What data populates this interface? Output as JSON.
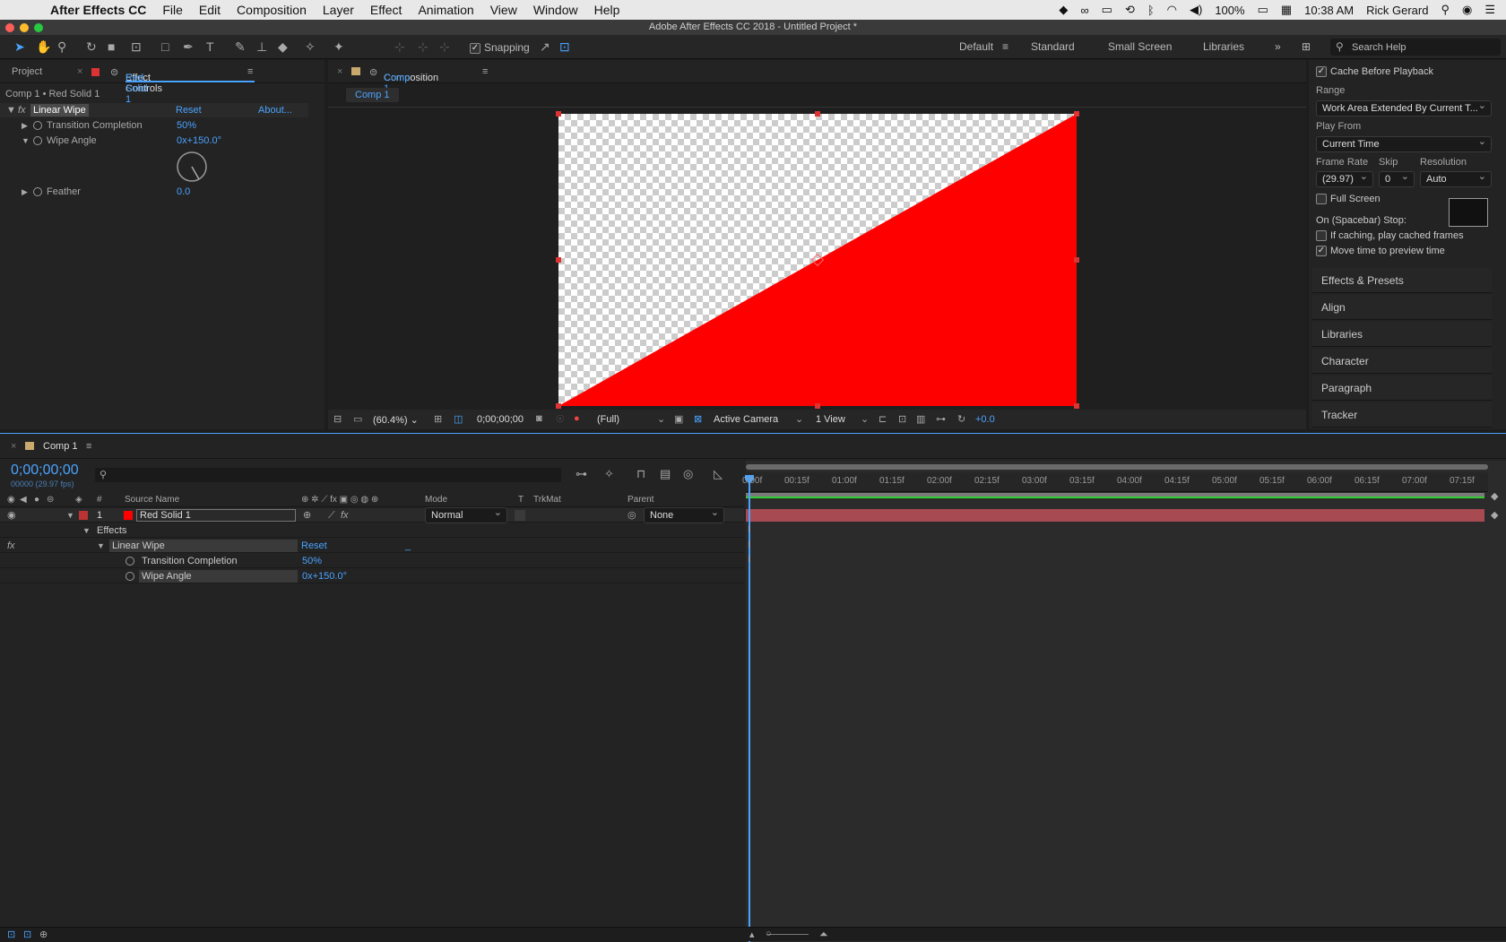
{
  "menubar": {
    "app": "After Effects CC",
    "items": [
      "File",
      "Edit",
      "Composition",
      "Layer",
      "Effect",
      "Animation",
      "View",
      "Window",
      "Help"
    ],
    "battery": "100%",
    "time": "10:38 AM",
    "user": "Rick Gerard"
  },
  "window_title": "Adobe After Effects CC 2018 - Untitled Project *",
  "toolbar": {
    "snapping": "Snapping",
    "workspaces": [
      "Default",
      "Standard",
      "Small Screen",
      "Libraries"
    ],
    "search_placeholder": "Search Help"
  },
  "left_panel": {
    "tab_project": "Project",
    "tab_effect_controls": "Effect Controls",
    "tab_effect_layer": "Red Solid 1",
    "breadcrumb": "Comp 1 • Red Solid 1",
    "effect_name": "Linear Wipe",
    "reset": "Reset",
    "about": "About...",
    "props": [
      {
        "label": "Transition Completion",
        "value": "50%"
      },
      {
        "label": "Wipe Angle",
        "value": "0x+150.0°"
      },
      {
        "label": "Feather",
        "value": "0.0"
      }
    ]
  },
  "comp_viewer": {
    "tab_label": "Composition",
    "tab_comp": "Comp 1",
    "crumb": "Comp 1",
    "zoom": "(60.4%)",
    "timecode": "0;00;00;00",
    "resolution": "(Full)",
    "camera": "Active Camera",
    "views": "1 View",
    "exposure": "+0.0",
    "transition_completion_pct": 50,
    "wipe_angle_deg": 150,
    "solid_color": "#ff0000"
  },
  "preview": {
    "cache": "Cache Before Playback",
    "range_label": "Range",
    "range_value": "Work Area Extended By Current T...",
    "play_from_label": "Play From",
    "play_from_value": "Current Time",
    "frame_rate_label": "Frame Rate",
    "skip_label": "Skip",
    "resolution_label": "Resolution",
    "frame_rate_value": "(29.97)",
    "skip_value": "0",
    "resolution_value": "Auto",
    "full_screen": "Full Screen",
    "on_stop": "On (Spacebar) Stop:",
    "if_caching": "If caching, play cached frames",
    "move_time": "Move time to preview time",
    "panels": [
      "Effects & Presets",
      "Align",
      "Libraries",
      "Character",
      "Paragraph",
      "Tracker"
    ]
  },
  "timeline": {
    "tab": "Comp 1",
    "timecode": "0;00;00;00",
    "frames": "00000 (29.97 fps)",
    "columns": {
      "source_name": "Source Name",
      "mode": "Mode",
      "t": "T",
      "trkmat": "TrkMat",
      "parent": "Parent",
      "num": "#"
    },
    "layer": {
      "num": "1",
      "name": "Red Solid 1",
      "mode": "Normal",
      "parent": "None",
      "color": "#ff0000"
    },
    "effects_label": "Effects",
    "effect_name": "Linear Wipe",
    "reset": "Reset",
    "props": [
      {
        "label": "Transition Completion",
        "value": "50%"
      },
      {
        "label": "Wipe Angle",
        "value": "0x+150.0°"
      }
    ],
    "ruler": [
      "00:15f",
      "01:00f",
      "01:15f",
      "02:00f",
      "02:15f",
      "03:00f",
      "03:15f",
      "04:00f",
      "04:15f",
      "05:00f",
      "05:15f",
      "06:00f",
      "06:15f",
      "07:00f",
      "07:15f"
    ],
    "ruler_start": "0:00f"
  }
}
